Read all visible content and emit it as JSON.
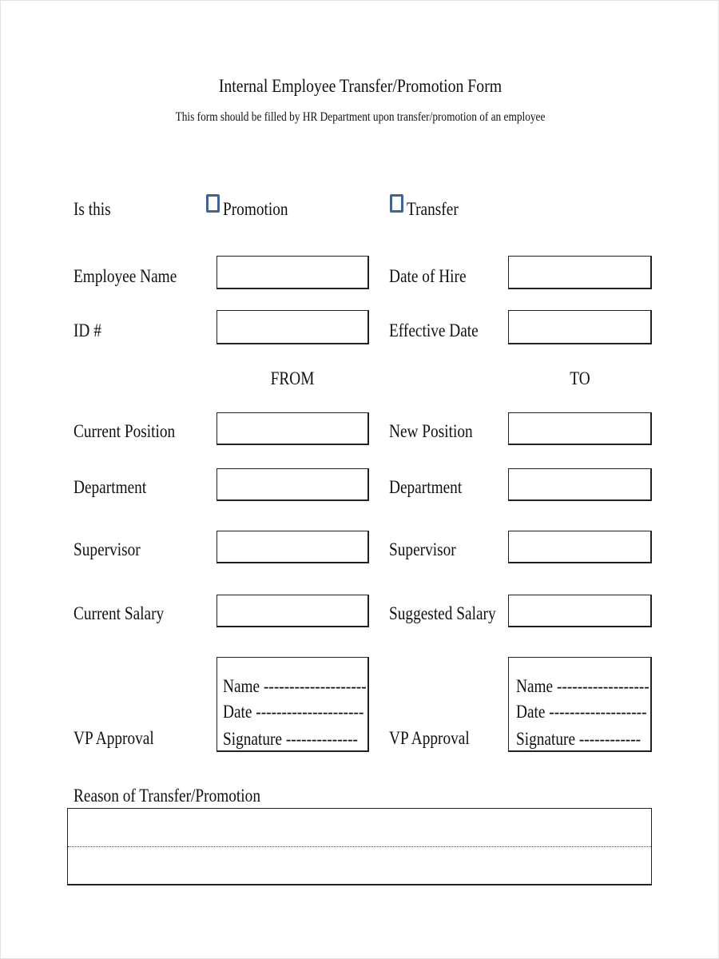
{
  "header": {
    "title": "Internal Employee Transfer/Promotion Form",
    "subtitle": "This form should be filled by HR Department  upon transfer/promotion of an employee"
  },
  "type_selection": {
    "label": "Is this",
    "options": [
      {
        "label": "Promotion",
        "checked": false
      },
      {
        "label": "Transfer",
        "checked": false
      }
    ],
    "checkbox_color": "#3f6596"
  },
  "employee": {
    "name_label": "Employee Name",
    "name_value": "",
    "id_label": "ID #",
    "id_value": "",
    "hire_label": "Date of Hire",
    "hire_value": "",
    "effective_label": "Effective Date",
    "effective_value": ""
  },
  "columns": {
    "from": "FROM",
    "to": "TO"
  },
  "from_fields": [
    {
      "label": "Current Position",
      "value": ""
    },
    {
      "label": "Department",
      "value": ""
    },
    {
      "label": " Supervisor",
      "value": ""
    },
    {
      "label": "Current Salary",
      "value": ""
    }
  ],
  "to_fields": [
    {
      "label": "New Position",
      "value": ""
    },
    {
      "label": "Department",
      "value": ""
    },
    {
      "label": "Supervisor",
      "value": ""
    },
    {
      "label": "Suggested Salary",
      "value": ""
    }
  ],
  "approval": {
    "from_label": "VP Approval",
    "to_label": "VP Approval",
    "from_box": {
      "name": "Name --------------------",
      "date": "Date ---------------------",
      "signature": "Signature --------------"
    },
    "to_box": {
      "name": "Name ------------------",
      "date": "Date -------------------",
      "signature": " Signature ------------"
    }
  },
  "reason": {
    "label": "Reason of Transfer/Promotion",
    "line1": "",
    "line2": ""
  }
}
